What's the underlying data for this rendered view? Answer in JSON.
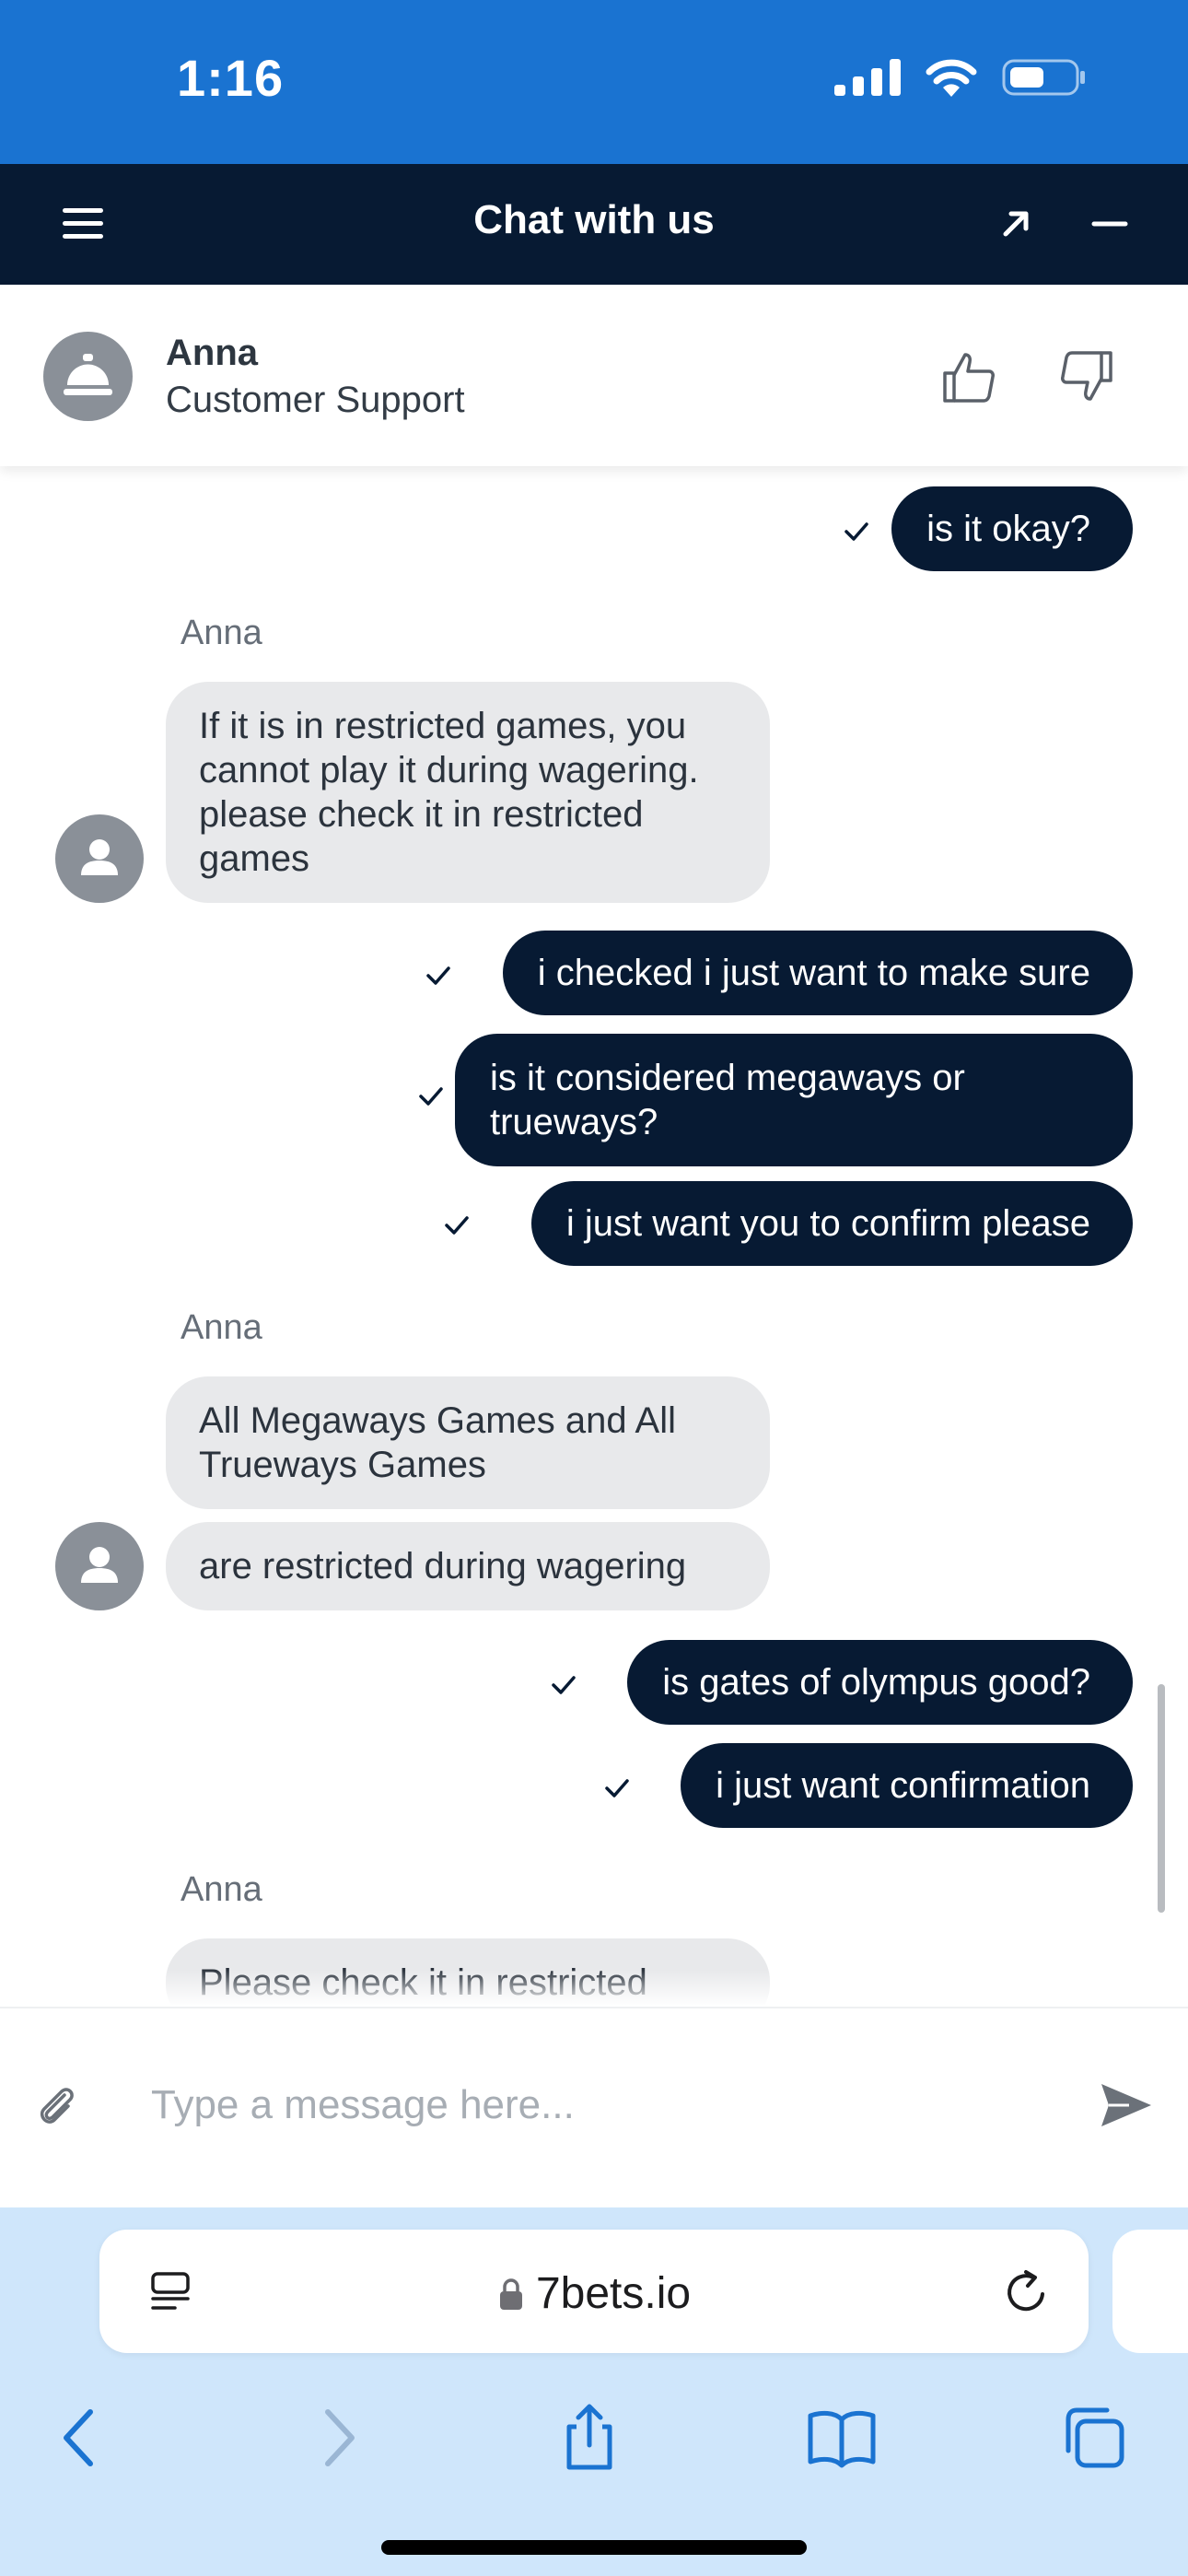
{
  "status_bar": {
    "time": "1:16"
  },
  "chat_header": {
    "title": "Chat with us"
  },
  "agent": {
    "name": "Anna",
    "role": "Customer Support"
  },
  "messages": {
    "out_1": "is it okay?",
    "in_1_sender": "Anna",
    "in_1": "If it is in restricted games, you cannot play it during wagering. please check it in restricted games",
    "out_2": "i checked i just want to make sure",
    "out_3": "is it considered megaways or trueways?",
    "out_4": "i just want you to confirm please",
    "in_2_sender": "Anna",
    "in_2a": "All Megaways Games and All Trueways Games",
    "in_2b": "are restricted during wagering",
    "out_5": "is gates of olympus good?",
    "out_6": "i just want confirmation",
    "in_3_sender": "Anna",
    "in_3": "Please check it in restricted"
  },
  "input": {
    "placeholder": "Type a message here..."
  },
  "browser": {
    "url": "7bets.io"
  },
  "colors": {
    "status_bar": "#1a73d1",
    "header": "#071a33",
    "outgoing_bubble": "#071a33",
    "incoming_bubble": "#e8e9eb",
    "browser_bar": "#cfe6fb",
    "accent_blue": "#1a73d1"
  },
  "icons": [
    "signal-icon",
    "wifi-icon",
    "battery-icon",
    "menu-icon",
    "expand-icon",
    "minimize-icon",
    "concierge-bell-icon",
    "thumbs-up-icon",
    "thumbs-down-icon",
    "check-icon",
    "user-icon",
    "paperclip-icon",
    "send-icon",
    "reader-icon",
    "lock-icon",
    "reload-icon",
    "back-icon",
    "forward-icon",
    "share-icon",
    "bookmarks-icon",
    "tabs-icon"
  ]
}
